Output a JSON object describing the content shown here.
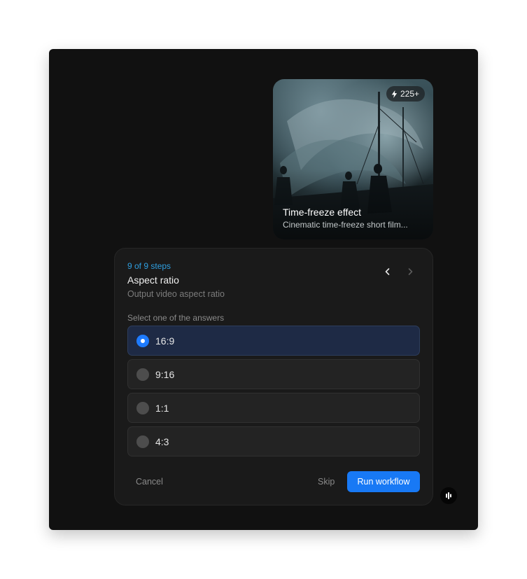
{
  "media_card": {
    "badge_count": "225+",
    "title": "Time-freeze effect",
    "subtitle": "Cinematic time-freeze short film..."
  },
  "step": {
    "progress": "9 of 9 steps",
    "title": "Aspect ratio",
    "description": "Output video aspect ratio",
    "select_label": "Select one of the answers",
    "options": [
      {
        "label": "16:9",
        "selected": true
      },
      {
        "label": "9:16",
        "selected": false
      },
      {
        "label": "1:1",
        "selected": false
      },
      {
        "label": "4:3",
        "selected": false
      }
    ]
  },
  "actions": {
    "cancel": "Cancel",
    "skip": "Skip",
    "run": "Run workflow"
  },
  "icons": {
    "badge": "lightning-icon",
    "prev": "chevron-left-icon",
    "next": "chevron-right-icon",
    "fab": "audio-bars-icon"
  },
  "colors": {
    "accent": "#1879f5",
    "step_count": "#2f9fe0",
    "selected_bg": "#1e2a45"
  }
}
